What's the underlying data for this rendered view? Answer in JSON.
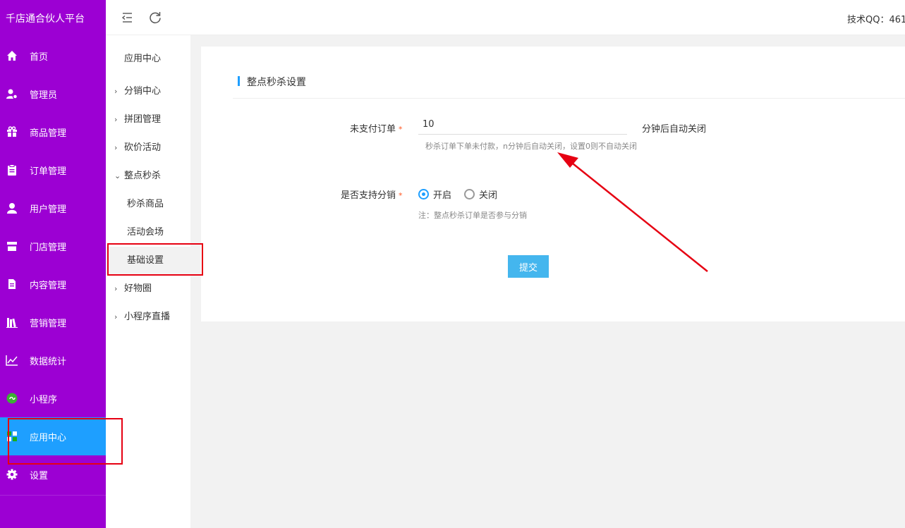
{
  "app": {
    "title": "千店通合伙人平台"
  },
  "sidebar": {
    "items": [
      {
        "label": "首页",
        "icon": "home-icon"
      },
      {
        "label": "管理员",
        "icon": "admin-icon"
      },
      {
        "label": "商品管理",
        "icon": "gift-icon"
      },
      {
        "label": "订单管理",
        "icon": "clipboard-icon"
      },
      {
        "label": "用户管理",
        "icon": "user-icon"
      },
      {
        "label": "门店管理",
        "icon": "store-icon"
      },
      {
        "label": "内容管理",
        "icon": "document-icon"
      },
      {
        "label": "营销管理",
        "icon": "books-icon"
      },
      {
        "label": "数据统计",
        "icon": "line-chart-icon"
      },
      {
        "label": "小程序",
        "icon": "miniprogram-icon"
      },
      {
        "label": "应用中心",
        "icon": "apps-icon",
        "active": true
      },
      {
        "label": "设置",
        "icon": "gear-icon"
      }
    ]
  },
  "submenu": {
    "title": "应用中心",
    "items": [
      {
        "label": "分销中心"
      },
      {
        "label": "拼团管理"
      },
      {
        "label": "砍价活动"
      },
      {
        "label": "整点秒杀",
        "expanded": true
      },
      {
        "label": "秒杀商品"
      },
      {
        "label": "活动会场"
      },
      {
        "label": "基础设置",
        "selected": true
      },
      {
        "label": "好物圈"
      },
      {
        "label": "小程序直播"
      }
    ]
  },
  "topbar": {
    "qq_label": "技术QQ：461"
  },
  "form": {
    "title": "整点秒杀设置",
    "unpaid": {
      "label": "未支付订单",
      "required_mark": "*",
      "value": "10",
      "suffix": "分钟后自动关闭",
      "hint": "秒杀订单下单未付款，n分钟后自动关闭，设置0则不自动关闭"
    },
    "distribution": {
      "label": "是否支持分销",
      "required_mark": "*",
      "option_on": "开启",
      "option_off": "关闭",
      "selected": "开启",
      "hint": "注：整点秒杀订单是否参与分销"
    },
    "submit_label": "提交"
  },
  "colors": {
    "sidebar_bg": "#9c00d3",
    "active_bg": "#1e9fff",
    "button_bg": "#44b6ee",
    "annotation": "#e60012"
  }
}
